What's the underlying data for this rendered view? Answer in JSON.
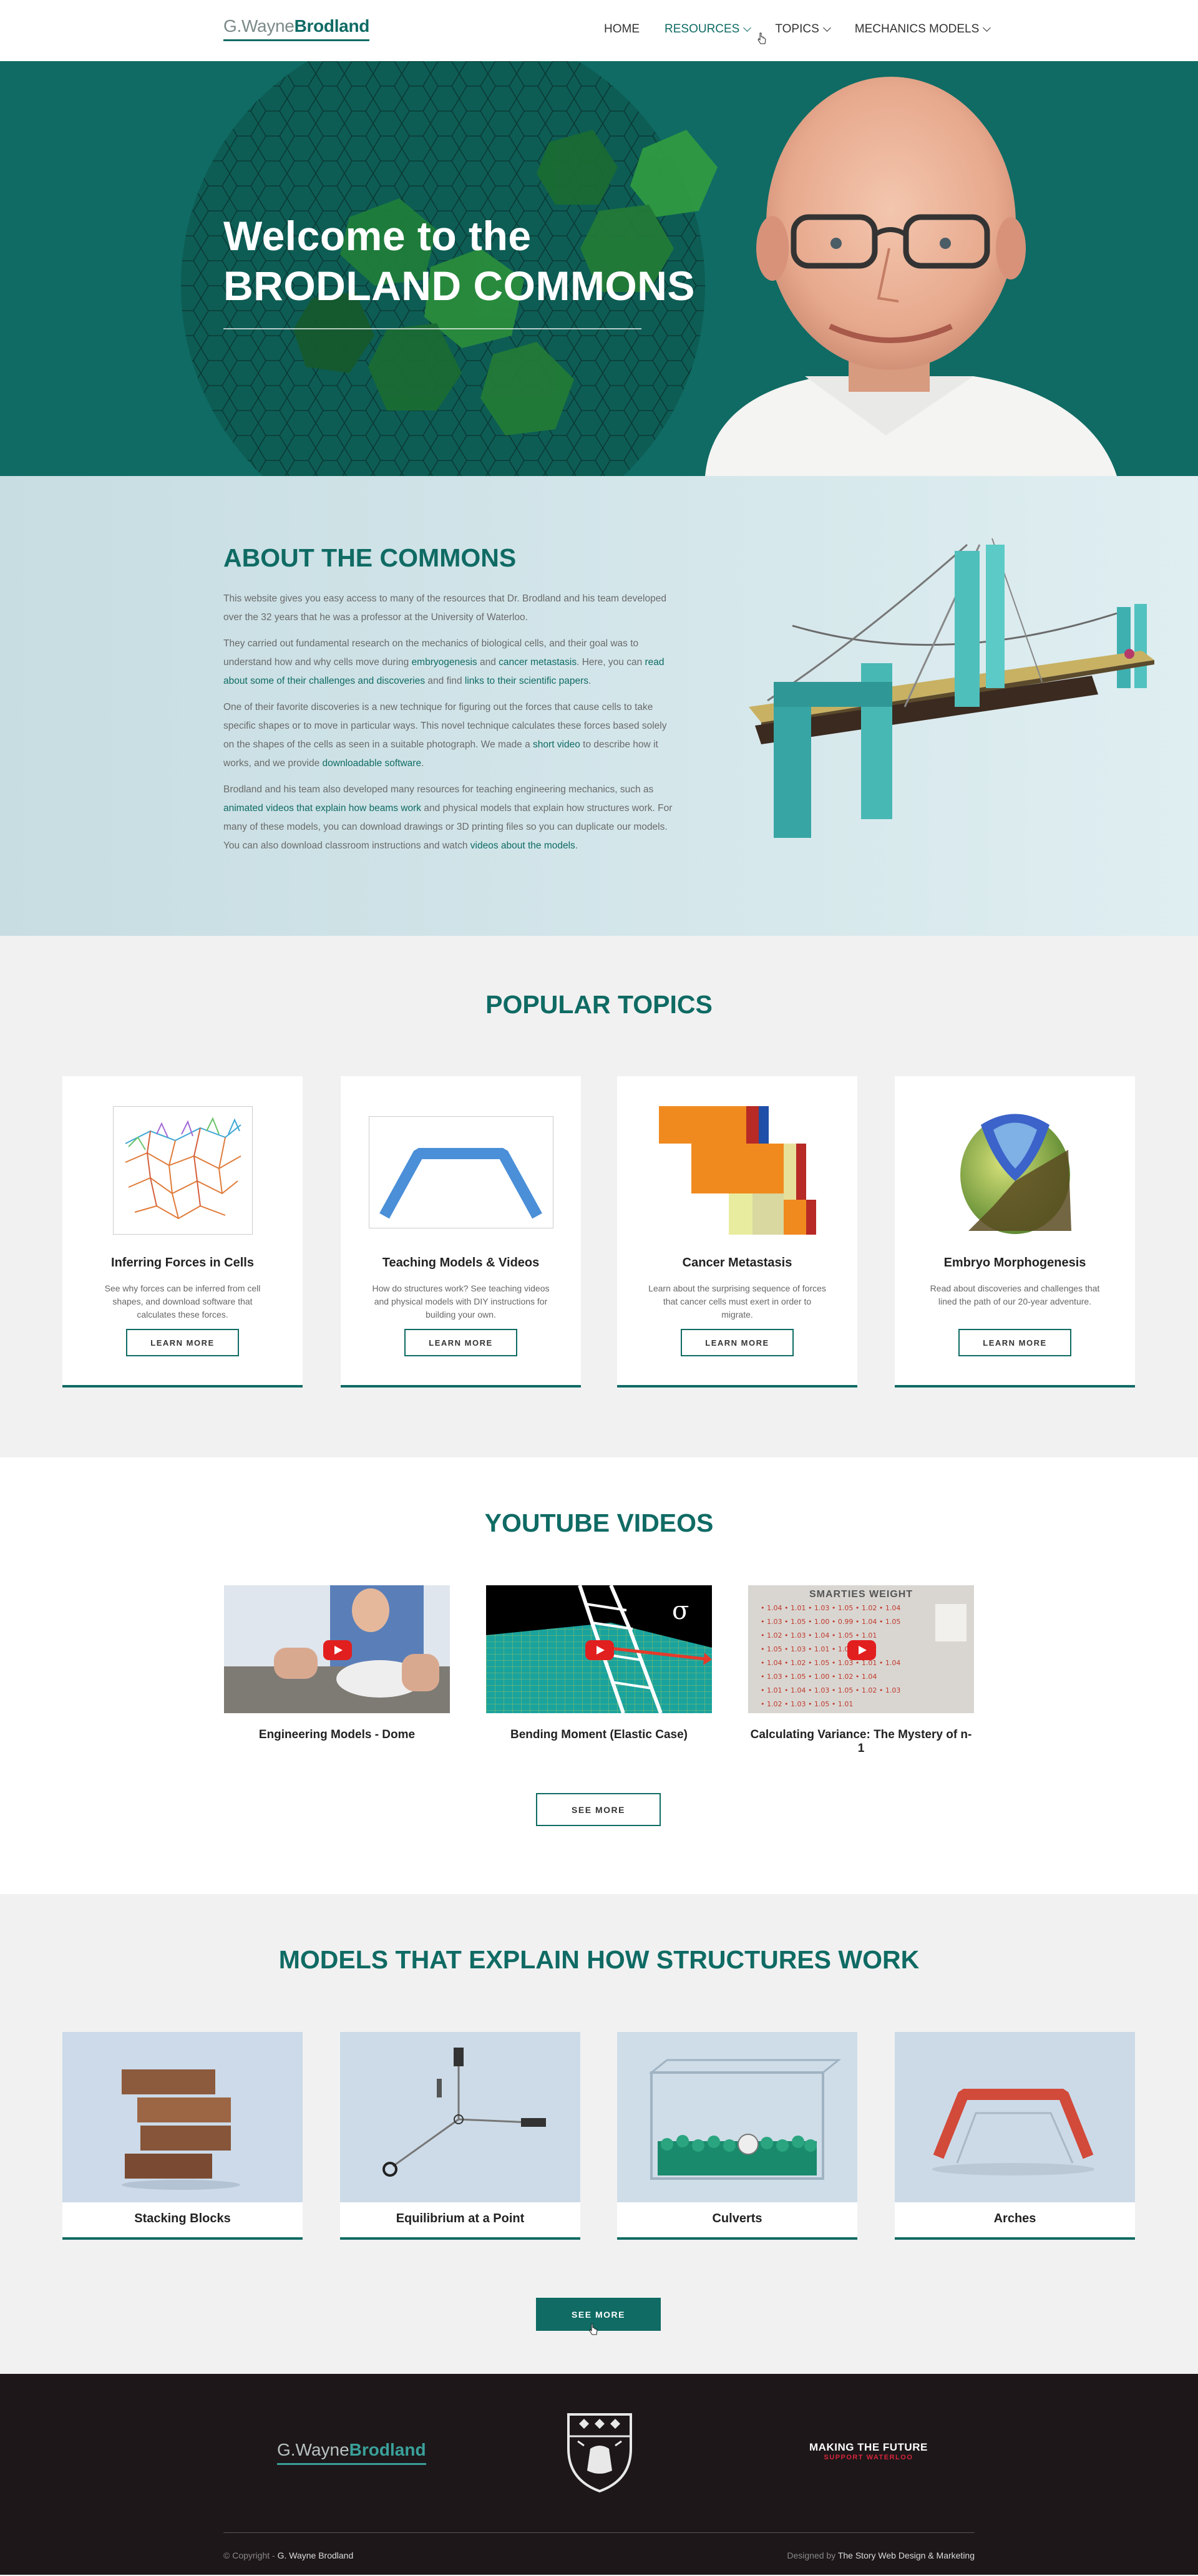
{
  "nav": {
    "logo_light": "G.Wayne",
    "logo_bold": "Brodland",
    "items": [
      {
        "label": "HOME",
        "dropdown": false
      },
      {
        "label": "RESOURCES",
        "dropdown": true
      },
      {
        "label": "TOPICS",
        "dropdown": true
      },
      {
        "label": "MECHANICS MODELS",
        "dropdown": true
      }
    ]
  },
  "hero": {
    "title_line1": "Welcome to the",
    "title_line2": "BRODLAND COMMONS"
  },
  "about": {
    "title": "ABOUT THE COMMONS",
    "p1": "This website gives you easy access to many of the resources that Dr. Brodland and his team developed over the 32 years that he was a professor at the University of Waterloo.",
    "p2_a": "They carried out fundamental research on the mechanics of biological cells, and their goal was to understand how and why cells move during ",
    "p2_link1": "embryogenesis",
    "p2_b": " and ",
    "p2_link2": "cancer metastasis",
    "p2_c": ". Here, you can ",
    "p2_link3": "read about some of their challenges and discoveries",
    "p2_d": " and find ",
    "p2_link4": "links to their scientific papers",
    "p2_e": ".",
    "p3_a": "One of their favorite discoveries is a new technique for figuring out the forces that cause cells to take specific shapes or to move in particular ways. This novel technique calculates these forces based solely on the shapes of the cells as seen in a suitable photograph. We made a ",
    "p3_link1": "short video",
    "p3_b": " to describe how it works, and we provide ",
    "p3_link2": "downloadable software",
    "p3_c": ".",
    "p4_a": "Brodland and his team also developed many resources for teaching engineering mechanics, such as ",
    "p4_link1": "animated videos that explain how beams work",
    "p4_b": " and physical models that explain how structures work. For many of these models, you can download drawings or 3D printing files so you can duplicate our models. You can also download classroom instructions and watch ",
    "p4_link2": "videos about the models",
    "p4_c": "."
  },
  "topics": {
    "title": "POPULAR TOPICS",
    "button_label": "LEARN MORE",
    "cards": [
      {
        "title": "Inferring Forces in Cells",
        "desc": "See why forces can be inferred from cell shapes, and download software that calculates these forces."
      },
      {
        "title": "Teaching Models & Videos",
        "desc": "How do structures work? See teaching videos and physical models with DIY instructions for building your own."
      },
      {
        "title": "Cancer Metastasis",
        "desc": "Learn about the surprising sequence of forces that cancer cells must exert in order to migrate."
      },
      {
        "title": "Embryo Morphogenesis",
        "desc": "Read about discoveries and challenges that lined the path of our 20-year adventure."
      }
    ]
  },
  "youtube": {
    "title": "YOUTUBE VIDEOS",
    "videos": [
      {
        "caption": "Engineering Models - Dome"
      },
      {
        "caption": "Bending Moment (Elastic Case)"
      },
      {
        "caption": "Calculating Variance: The Mystery of n-1"
      }
    ],
    "thumb2_symbol": "σ",
    "thumb3_heading": "SMARTIES WEIGHT",
    "see_more": "SEE MORE"
  },
  "models": {
    "title": "MODELS THAT EXPLAIN HOW STRUCTURES WORK",
    "cards": [
      {
        "title": "Stacking Blocks"
      },
      {
        "title": "Equilibrium at a Point"
      },
      {
        "title": "Culverts"
      },
      {
        "title": "Arches"
      }
    ],
    "see_more": "SEE MORE"
  },
  "footer": {
    "logo_light": "G.Wayne",
    "logo_bold": "Brodland",
    "mtf_line1": "MAKING THE FUTURE",
    "mtf_line2": "SUPPORT WATERLOO",
    "copyright_prefix": "© Copyright - ",
    "copyright_name": "G. Wayne Brodland",
    "designed_prefix": "Designed by ",
    "designed_name": "The Story Web Design & Marketing"
  },
  "colors": {
    "brand": "#0f6b64",
    "footer_bg": "#1d1719",
    "section_gray": "#f1f1f1",
    "about_bg": "#cfe2e6"
  }
}
